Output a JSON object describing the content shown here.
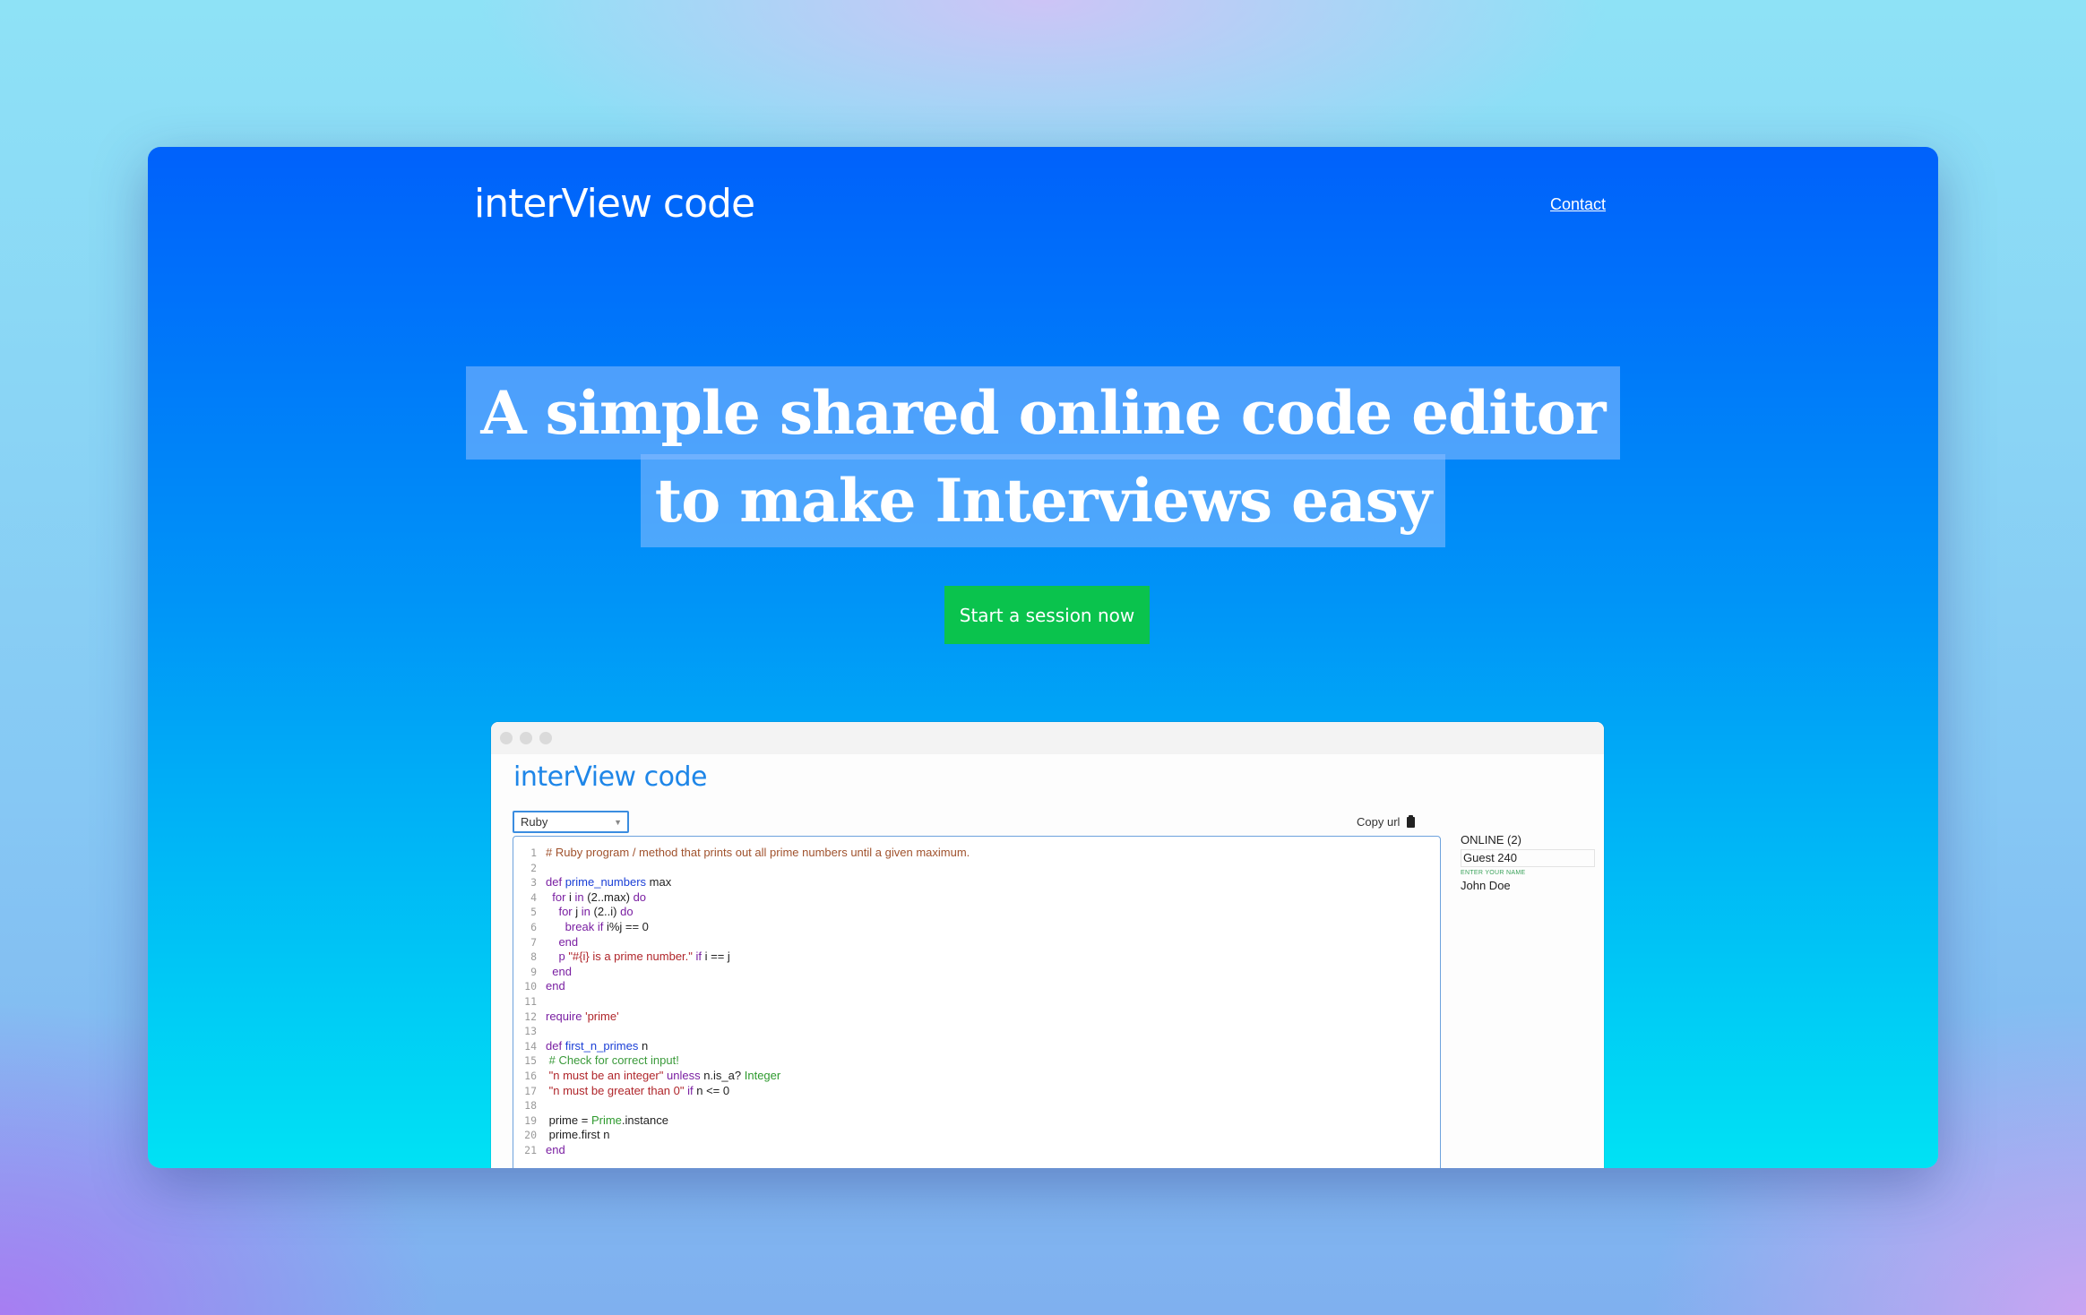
{
  "header": {
    "brand": "interView code",
    "contact_label": "Contact"
  },
  "hero": {
    "line1": "A simple shared online code editor",
    "line2": "to make Interviews easy",
    "cta_label": "Start a session now"
  },
  "preview": {
    "brand": "interView code",
    "language": "Ruby",
    "copy_url_label": "Copy url",
    "online_title": "ONLINE (2)",
    "guest_name": "Guest 240",
    "name_hint": "ENTER YOUR NAME",
    "other_user": "John Doe",
    "code": [
      {
        "n": "1",
        "t": "# Ruby program / method that prints out all prime numbers until a given maximum.",
        "c": "#a0522d"
      },
      {
        "n": "2",
        "t": "",
        "c": "#222"
      },
      {
        "n": "3",
        "t": "def prime_numbers max",
        "c": "#222"
      },
      {
        "n": "4",
        "t": "  for i in (2..max) do",
        "c": "#222"
      },
      {
        "n": "5",
        "t": "    for j in (2..i) do",
        "c": "#222"
      },
      {
        "n": "6",
        "t": "      break if i%j == 0",
        "c": "#222"
      },
      {
        "n": "7",
        "t": "    end",
        "c": "#222"
      },
      {
        "n": "8",
        "t": "    p \"#{i} is a prime number.\" if i == j",
        "c": "#222"
      },
      {
        "n": "9",
        "t": "  end",
        "c": "#222"
      },
      {
        "n": "10",
        "t": "end",
        "c": "#222"
      },
      {
        "n": "11",
        "t": "",
        "c": "#222"
      },
      {
        "n": "12",
        "t": "require 'prime'",
        "c": "#222"
      },
      {
        "n": "13",
        "t": "",
        "c": "#222"
      },
      {
        "n": "14",
        "t": "def first_n_primes n",
        "c": "#222"
      },
      {
        "n": "15",
        "t": " # Check for correct input!",
        "c": "#222"
      },
      {
        "n": "16",
        "t": " \"n must be an integer\" unless n.is_a? Integer",
        "c": "#222"
      },
      {
        "n": "17",
        "t": " \"n must be greater than 0\" if n <= 0",
        "c": "#222"
      },
      {
        "n": "18",
        "t": "",
        "c": "#222"
      },
      {
        "n": "19",
        "t": " prime = Prime.instance",
        "c": "#222"
      },
      {
        "n": "20",
        "t": " prime.first n",
        "c": "#222"
      },
      {
        "n": "21",
        "t": "end",
        "c": "#222"
      }
    ]
  },
  "colors": {
    "keyword": "#7a1fa2",
    "function": "#1a3fd6",
    "string": "#b0262b",
    "comment": "#a0522d",
    "comment_green": "#3a9a3a",
    "constant": "#2e9a2e",
    "cta": "#0ac34d"
  }
}
